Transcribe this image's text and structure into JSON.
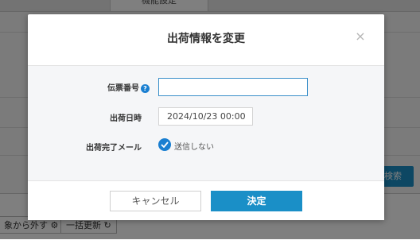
{
  "background": {
    "tab_label": "機能設定",
    "search_button": "検索",
    "remove_button": "象から外す",
    "bulk_update_button": "一括更新"
  },
  "modal": {
    "title": "出荷情報を変更",
    "close_symbol": "×",
    "fields": {
      "slip_number_label": "伝票番号",
      "slip_number_value": "",
      "ship_datetime_label": "出荷日時",
      "ship_datetime_value": "2024/10/23 00:00",
      "ship_mail_label": "出荷完了メール",
      "ship_mail_option": "送信しない"
    },
    "help_symbol": "?",
    "cancel_label": "キャンセル",
    "confirm_label": "決定"
  },
  "colors": {
    "accent": "#1a8fc7",
    "help_icon": "#1a7fd1"
  }
}
